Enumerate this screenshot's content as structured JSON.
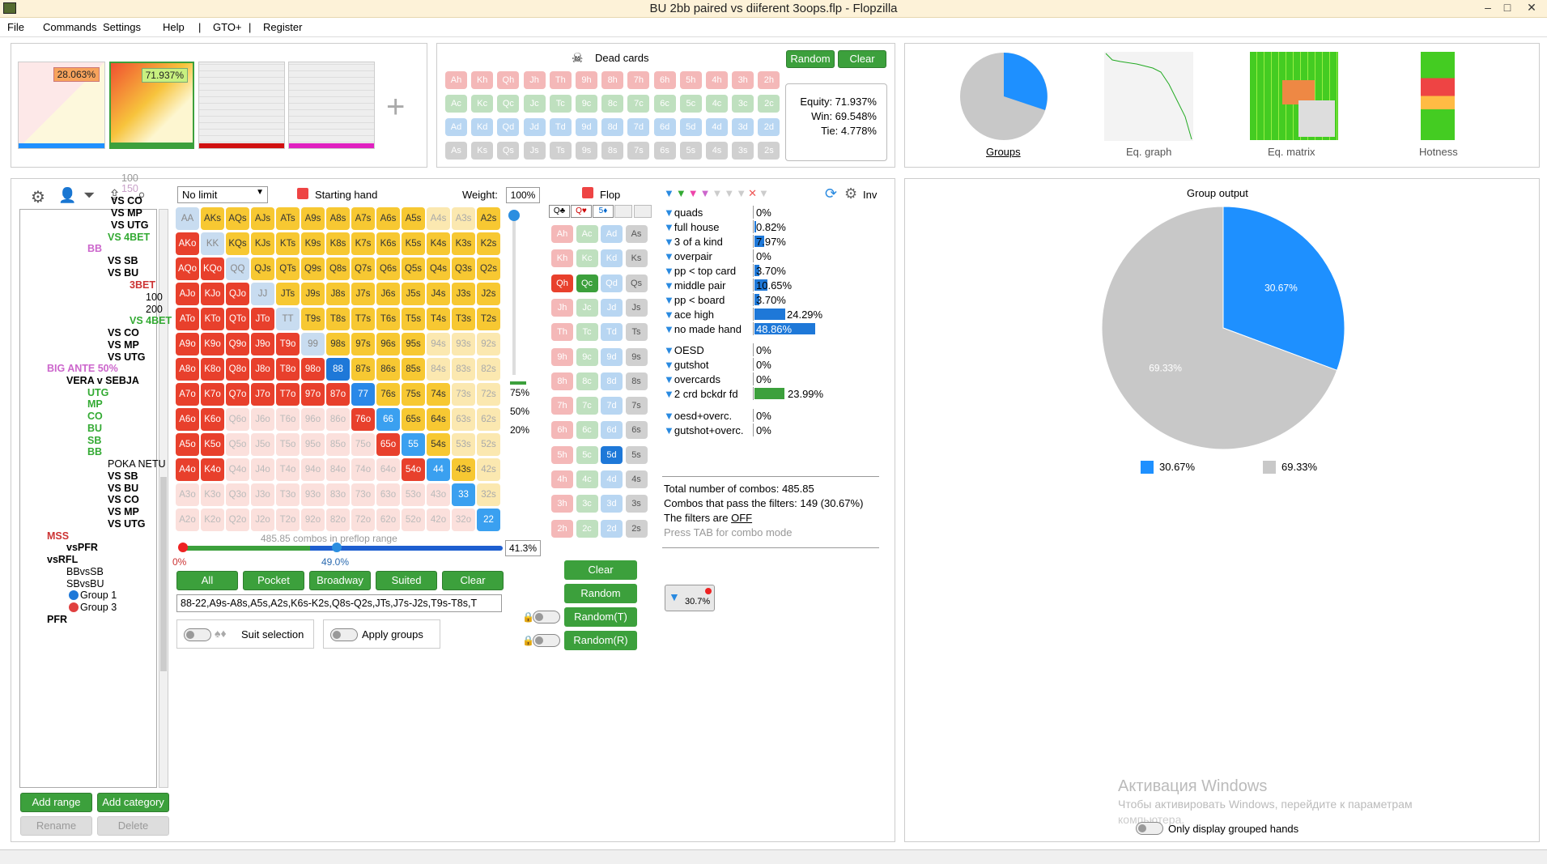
{
  "window": {
    "title": "BU 2bb paired vs diiferent 3oops.flp - Flopzilla"
  },
  "menu": [
    "File",
    "Commands",
    "Settings",
    "Help",
    "|",
    "GTO+",
    "|",
    "Register"
  ],
  "thumbs": [
    {
      "pct": "28.063%"
    },
    {
      "pct": "71.937%"
    }
  ],
  "dead_cards": {
    "title": "Dead cards",
    "random": "Random",
    "clear": "Clear"
  },
  "ranks": [
    "A",
    "K",
    "Q",
    "J",
    "T",
    "9",
    "8",
    "7",
    "6",
    "5",
    "4",
    "3",
    "2"
  ],
  "equity": {
    "equity": "Equity: 71.937%",
    "win": "Win: 69.548%",
    "tie": "Tie: 4.778%"
  },
  "views": [
    {
      "label": "Groups"
    },
    {
      "label": "Eq. graph"
    },
    {
      "label": "Eq. matrix"
    },
    {
      "label": "Hotness"
    }
  ],
  "toolbar": {
    "limit": "No limit",
    "starting_hand": "Starting hand",
    "weight_label": "Weight:",
    "weight": "100%"
  },
  "range": {
    "combos": "485.85 combos in preflop range",
    "pct": "41.3%",
    "slider_left": "0%",
    "slider_mid": "49.0%",
    "wv": [
      "75%",
      "50%",
      "20%"
    ],
    "buttons": [
      "All",
      "Pocket",
      "Broadway",
      "Suited",
      "Clear"
    ],
    "text": "88-22,A9s-A8s,A5s,A2s,K6s-K2s,Q8s-Q2s,JTs,J7s-J2s,T9s-T8s,T",
    "suit_selection": "Suit selection",
    "apply_groups": "Apply groups"
  },
  "tree": [
    {
      "t": "100",
      "x": 150,
      "y": 213,
      "c": "#999"
    },
    {
      "t": "150",
      "x": 150,
      "y": 226,
      "c": "#c8a0c8"
    },
    {
      "t": "VS CO",
      "x": 137,
      "y": 241,
      "c": "#000",
      "b": 1
    },
    {
      "t": "VS MP",
      "x": 137,
      "y": 256,
      "c": "#000",
      "b": 1
    },
    {
      "t": "VS UTG",
      "x": 137,
      "y": 271,
      "c": "#000",
      "b": 1
    },
    {
      "t": "VS 4BET",
      "x": 133,
      "y": 286,
      "c": "#3a3",
      "b": 1
    },
    {
      "t": "BB",
      "x": 108,
      "y": 300,
      "c": "#c6c",
      "b": 1
    },
    {
      "t": "VS SB",
      "x": 133,
      "y": 315,
      "c": "#000",
      "b": 1
    },
    {
      "t": "VS BU",
      "x": 133,
      "y": 330,
      "c": "#000",
      "b": 1
    },
    {
      "t": "3BET",
      "x": 160,
      "y": 345,
      "c": "#c33",
      "b": 1
    },
    {
      "t": "100",
      "x": 180,
      "y": 360,
      "c": "#000"
    },
    {
      "t": "200",
      "x": 180,
      "y": 375,
      "c": "#000"
    },
    {
      "t": "VS 4BET",
      "x": 160,
      "y": 389,
      "c": "#3a3",
      "b": 1
    },
    {
      "t": "VS CO",
      "x": 133,
      "y": 404,
      "c": "#000",
      "b": 1
    },
    {
      "t": "VS MP",
      "x": 133,
      "y": 419,
      "c": "#000",
      "b": 1
    },
    {
      "t": "VS UTG",
      "x": 133,
      "y": 434,
      "c": "#000",
      "b": 1
    },
    {
      "t": "BIG ANTE 50%",
      "x": 58,
      "y": 448,
      "c": "#c6c",
      "b": 1
    },
    {
      "t": "VERA v SEBJA",
      "x": 82,
      "y": 463,
      "c": "#000",
      "b": 1
    },
    {
      "t": "UTG",
      "x": 108,
      "y": 478,
      "c": "#3a3",
      "b": 1
    },
    {
      "t": "MP",
      "x": 108,
      "y": 492,
      "c": "#3a3",
      "b": 1
    },
    {
      "t": "CO",
      "x": 108,
      "y": 507,
      "c": "#3a3",
      "b": 1
    },
    {
      "t": "BU",
      "x": 108,
      "y": 522,
      "c": "#3a3",
      "b": 1
    },
    {
      "t": "SB",
      "x": 108,
      "y": 537,
      "c": "#3a3",
      "b": 1
    },
    {
      "t": "BB",
      "x": 108,
      "y": 551,
      "c": "#3a3",
      "b": 1
    },
    {
      "t": "POKA NETU",
      "x": 133,
      "y": 566,
      "c": "#000"
    },
    {
      "t": "VS SB",
      "x": 133,
      "y": 581,
      "c": "#000",
      "b": 1
    },
    {
      "t": "VS BU",
      "x": 133,
      "y": 596,
      "c": "#000",
      "b": 1
    },
    {
      "t": "VS CO",
      "x": 133,
      "y": 610,
      "c": "#000",
      "b": 1
    },
    {
      "t": "VS MP",
      "x": 133,
      "y": 625,
      "c": "#000",
      "b": 1
    },
    {
      "t": "VS UTG",
      "x": 133,
      "y": 640,
      "c": "#000",
      "b": 1
    },
    {
      "t": "MSS",
      "x": 58,
      "y": 655,
      "c": "#c33",
      "b": 1
    },
    {
      "t": "vsPFR",
      "x": 82,
      "y": 669,
      "c": "#000",
      "b": 1
    },
    {
      "t": "vsRFL",
      "x": 58,
      "y": 684,
      "c": "#000",
      "b": 1
    },
    {
      "t": "BBvsSB",
      "x": 82,
      "y": 699,
      "c": "#000"
    },
    {
      "t": "SBvsBU",
      "x": 82,
      "y": 714,
      "c": "#000"
    },
    {
      "t": "Group 1",
      "x": 99,
      "y": 728,
      "c": "#000"
    },
    {
      "t": "Group 3",
      "x": 99,
      "y": 743,
      "c": "#000"
    },
    {
      "t": "PFR",
      "x": 58,
      "y": 758,
      "c": "#000",
      "b": 1
    }
  ],
  "tree_buttons": {
    "add_range": "Add range",
    "add_category": "Add category",
    "rename": "Rename",
    "delete": "Delete"
  },
  "flop": {
    "title": "Flop",
    "clear": "Clear",
    "random": "Random",
    "random_t": "Random(T)",
    "random_r": "Random(R)",
    "inv": "Inv"
  },
  "filters": [
    {
      "n": "quads",
      "v": "0%",
      "w": 0
    },
    {
      "n": "full house",
      "v": "0.82%",
      "w": 2
    },
    {
      "n": "3 of a kind",
      "v": "7.97%",
      "w": 12
    },
    {
      "n": "overpair",
      "v": "0%",
      "w": 0
    },
    {
      "n": "pp < top card",
      "v": "3.70%",
      "w": 6
    },
    {
      "n": "middle pair",
      "v": "10.65%",
      "w": 16
    },
    {
      "n": "pp < board",
      "v": "3.70%",
      "w": 6
    },
    {
      "n": "ace high",
      "v": "24.29%",
      "w": 38
    },
    {
      "n": "no made hand",
      "v": "48.86%",
      "w": 75
    }
  ],
  "draws": [
    {
      "n": "OESD",
      "v": "0%",
      "w": 0
    },
    {
      "n": "gutshot",
      "v": "0%",
      "w": 0
    },
    {
      "n": "overcards",
      "v": "0%",
      "w": 0
    },
    {
      "n": "2 crd bckdr fd",
      "v": "23.99%",
      "w": 37
    }
  ],
  "draws2": [
    {
      "n": "oesd+overc.",
      "v": "0%"
    },
    {
      "n": "gutshot+overc.",
      "v": "0%"
    }
  ],
  "totals": {
    "l1": "Total number of combos: 485.85",
    "l2": "Combos that pass the filters: 149 (30.67%)",
    "l3": "The filters are ",
    "off": "OFF",
    "l4": "Press TAB for combo mode",
    "btn_pct": "30.7%"
  },
  "group_output": {
    "title": "Group output",
    "blue": "30.67%",
    "grey": "69.33%",
    "only_grouped": "Only display grouped hands"
  },
  "watermark": {
    "l1": "Активация Windows",
    "l2": "Чтобы активировать Windows, перейдите к параметрам",
    "l3": "компьютера."
  },
  "chart_data": {
    "type": "pie",
    "title": "Group output",
    "series": [
      {
        "name": "30.67%",
        "value": 30.67,
        "color": "#1e90ff"
      },
      {
        "name": "69.33%",
        "value": 69.33,
        "color": "#c8c8c8"
      }
    ]
  },
  "colors": {
    "green": "#3ca03c",
    "blue": "#1e90ff"
  }
}
